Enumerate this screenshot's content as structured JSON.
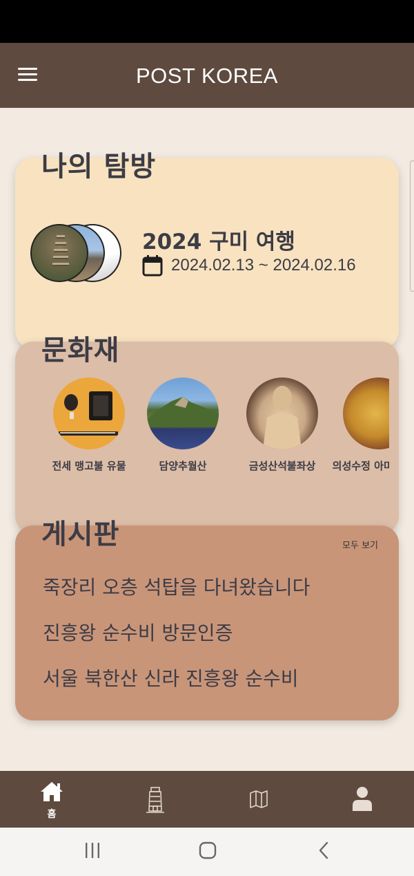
{
  "app_bar": {
    "title": "POST KOREA",
    "menu_icon": "hamburger-menu-icon"
  },
  "trip_section": {
    "title": "나의 탐방",
    "trip_name": "2024 구미 여행",
    "dates": "2024.02.13 ~ 2024.02.16",
    "date_icon": "calendar-icon"
  },
  "heritage_section": {
    "title": "문화재",
    "items": [
      {
        "label": "전세 맹고불 유물"
      },
      {
        "label": "담양추월산"
      },
      {
        "label": "금성산석불좌상"
      },
      {
        "label": "의성수정 아미타상 좌"
      }
    ]
  },
  "board_section": {
    "title": "게시판",
    "see_all": "모두 보기",
    "posts": [
      "죽장리 오층 석탑을 다녀왔습니다",
      "진흥왕 순수비 방문인증",
      "서울 북한산 신라 진흥왕 순수비"
    ]
  },
  "bottom_nav": {
    "items": [
      {
        "label": "홈",
        "icon": "home-icon",
        "active": true
      },
      {
        "label": "",
        "icon": "tower-icon",
        "active": false
      },
      {
        "label": "",
        "icon": "map-icon",
        "active": false
      },
      {
        "label": "",
        "icon": "user-icon",
        "active": false
      }
    ]
  },
  "colors": {
    "app_bar": "#5e4a3f",
    "background": "#f3ebe1",
    "trip_card": "#f8e2c0",
    "heritage_card": "#dcbda8",
    "board_card": "#c99579"
  }
}
